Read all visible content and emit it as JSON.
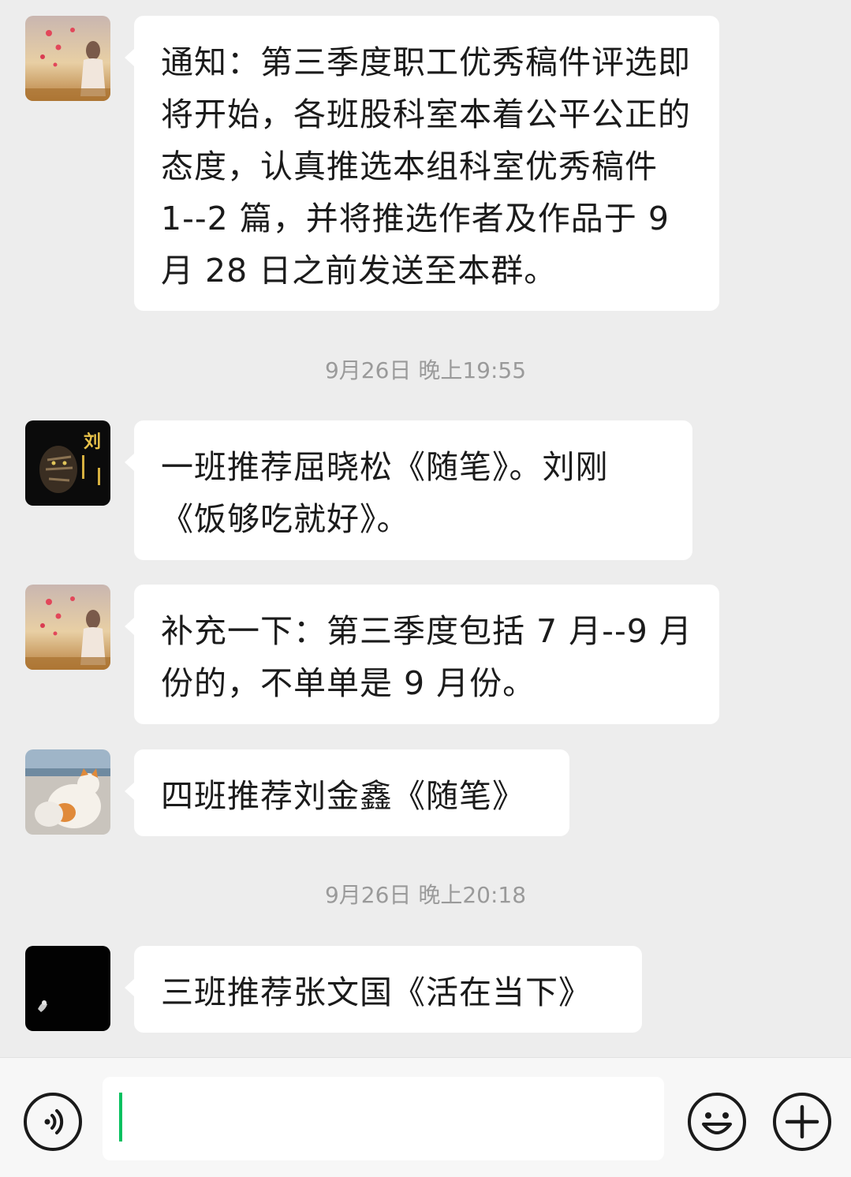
{
  "messages": [
    {
      "text": "通知：第三季度职工优秀稿件评选即将开始，各班股科室本着公平公正的态度，认真推选本组科室优秀稿件 1--2 篇，并将推选作者及作品于 9 月 28 日之前发送至本群。",
      "avatar": "girl-sunset-avatar"
    },
    {
      "text": "一班推荐屈晓松《随笔》。刘刚《饭够吃就好》。",
      "avatar": "tiger-liu-avatar"
    },
    {
      "text": "补充一下：第三季度包括 7 月--9 月份的，不单单是 9 月份。",
      "avatar": "girl-sunset-avatar"
    },
    {
      "text": "四班推荐刘金鑫《随笔》",
      "avatar": "cat-seaside-avatar"
    },
    {
      "text": "三班推荐张文国《活在当下》",
      "avatar": "dark-bird-avatar"
    }
  ],
  "timestamps": [
    "9月26日 晚上19:55",
    "9月26日 晚上20:18"
  ],
  "input": {
    "value": "",
    "voice_icon": "voice-icon",
    "emoji_icon": "emoji-icon",
    "add_icon": "plus-icon"
  },
  "colors": {
    "chat_background": "#ededed",
    "bubble": "#ffffff",
    "caret": "#07c160"
  }
}
